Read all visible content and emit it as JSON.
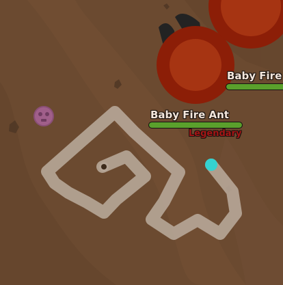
{
  "game": {
    "colors": {
      "ground": "#6b4a30",
      "path": "#b5a596",
      "fire_ant_body": "#8c1e07",
      "fire_ant_core": "#a63412",
      "ant_legs": "#232323",
      "healthbar_fill": "#5aa02c",
      "rarity_legendary": "#a51515",
      "player_dot": "#34d2d0",
      "pickup": "#a05f8a"
    },
    "mobs": [
      {
        "name": "Baby Fire Ant",
        "rarity": "Legendary",
        "health": 1.0
      },
      {
        "name": "Baby Fire Ant",
        "health": 1.0
      }
    ],
    "icons": {
      "pickup": "skull-petal-icon",
      "player": "player-marker-icon"
    }
  }
}
